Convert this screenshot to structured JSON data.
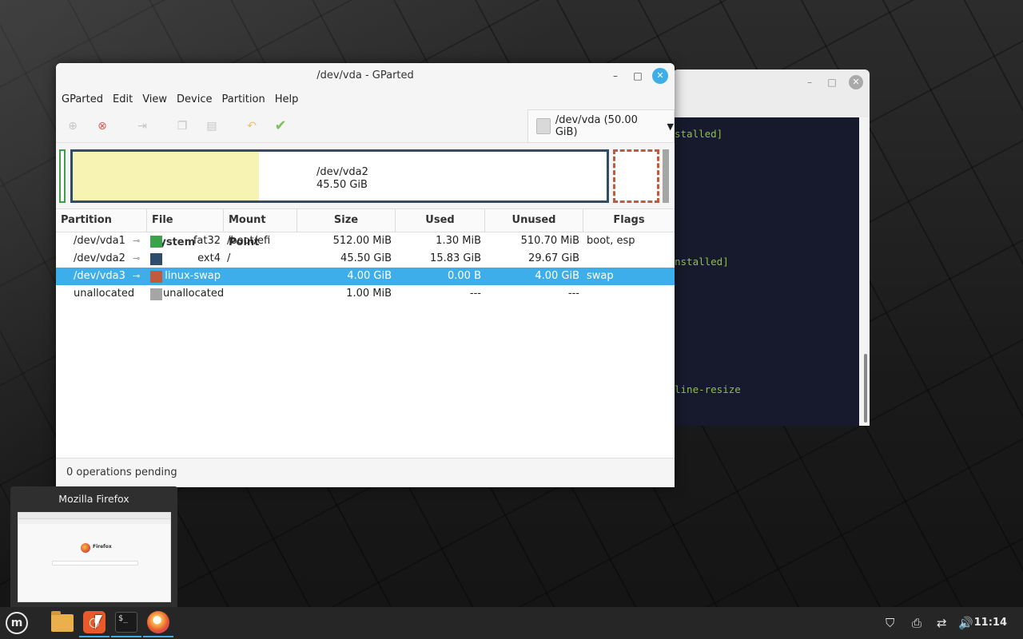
{
  "terminal": {
    "lines": [
      "stalled]",
      "nstalled]",
      "line-resize"
    ]
  },
  "window": {
    "title": "/dev/vda - GParted",
    "minimize": "–",
    "maximize": "□",
    "close": "✕"
  },
  "menu": [
    "GParted",
    "Edit",
    "View",
    "Device",
    "Partition",
    "Help"
  ],
  "toolbar": {
    "icons": [
      "new-icon",
      "delete-icon",
      "resize-icon",
      "copy-icon",
      "paste-icon",
      "undo-icon",
      "apply-icon"
    ],
    "device": "/dev/vda (50.00 GiB)"
  },
  "map": {
    "label_name": "/dev/vda2",
    "label_size": "45.50 GiB"
  },
  "table": {
    "headers": [
      "Partition",
      "File System",
      "Mount Point",
      "Size",
      "Used",
      "Unused",
      "Flags"
    ],
    "rows": [
      {
        "partition": "/dev/vda1",
        "fs": "fat32",
        "mount": "/boot/efi",
        "size": "512.00 MiB",
        "used": "1.30 MiB",
        "unused": "510.70 MiB",
        "flags": "boot, esp",
        "color": "#3aa24a",
        "selected": false
      },
      {
        "partition": "/dev/vda2",
        "fs": "ext4",
        "mount": "/",
        "size": "45.50 GiB",
        "used": "15.83 GiB",
        "unused": "29.67 GiB",
        "flags": "",
        "color": "#2e4d6b",
        "selected": false
      },
      {
        "partition": "/dev/vda3",
        "fs": "linux-swap",
        "mount": "",
        "size": "4.00 GiB",
        "used": "0.00 B",
        "unused": "4.00 GiB",
        "flags": "swap",
        "color": "#c25a3c",
        "selected": true
      },
      {
        "partition": "unallocated",
        "fs": "unallocated",
        "mount": "",
        "size": "1.00 MiB",
        "used": "---",
        "unused": "---",
        "flags": "",
        "color": "#a5a5a5",
        "selected": false
      }
    ]
  },
  "status": "0 operations pending",
  "preview": {
    "title": "Mozilla Firefox",
    "page_label": "Firefox"
  },
  "taskbar": {
    "items": [
      "menu-icon",
      "files-icon",
      "gparted-icon",
      "terminal-icon",
      "firefox-icon"
    ],
    "clock": "11:14"
  },
  "colors": {
    "accent": "#3daee9",
    "fat32": "#3aa24a",
    "ext4": "#2e4d6b",
    "swap": "#c25a3c",
    "unallocated": "#a5a5a5"
  }
}
